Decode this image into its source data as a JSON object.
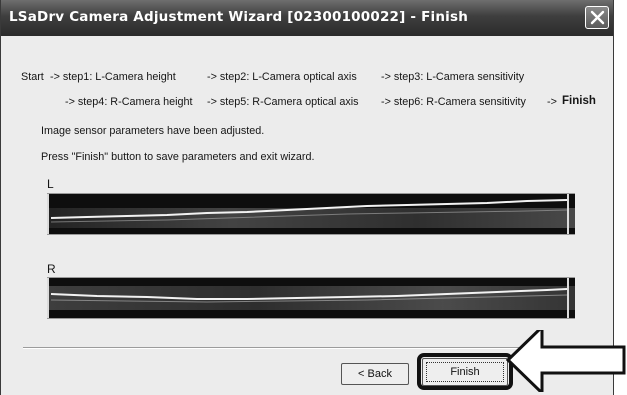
{
  "window": {
    "title": "LSaDrv Camera Adjustment Wizard [02300100022] - Finish"
  },
  "steps": {
    "row1": [
      "Start",
      "-> step1: L-Camera height",
      "-> step2: L-Camera optical axis",
      "-> step3: L-Camera sensitivity"
    ],
    "row2": [
      "-> step4: R-Camera height",
      "-> step5: R-Camera optical axis",
      "-> step6: R-Camera sensitivity"
    ],
    "final_prefix": "->",
    "final_label": "Finish"
  },
  "messages": {
    "line1": "Image sensor parameters have been adjusted.",
    "line2": "Press \"Finish\" button to save parameters and exit wizard."
  },
  "sensors": {
    "left_label": "L",
    "right_label": "R"
  },
  "buttons": {
    "back_label": "< Back",
    "finish_label": "Finish"
  },
  "icons": {
    "close": "close-icon",
    "pointer": "pointer-arrow-icon"
  },
  "colors": {
    "titlebar": "#3e3e3e",
    "dialog_bg": "#ececec",
    "strip_bg": "#0e0e0e",
    "highlight": "#111111"
  }
}
